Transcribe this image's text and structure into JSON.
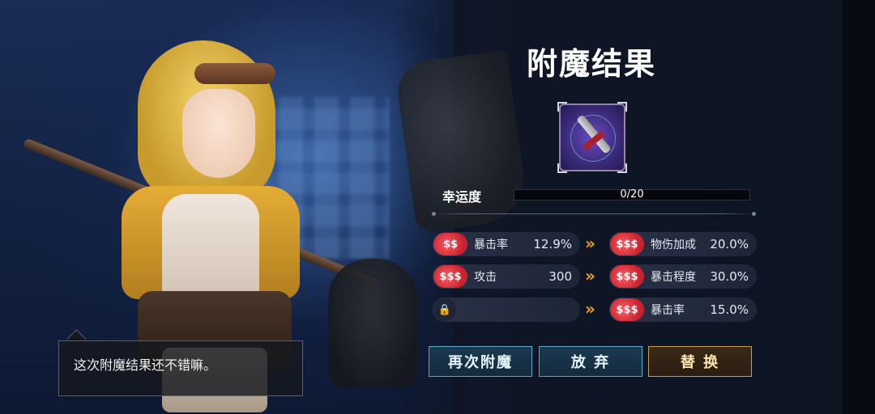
{
  "title": "附魔结果",
  "dialogue": {
    "text": "这次附魔结果还不错嘛。"
  },
  "luck": {
    "label": "幸运度",
    "value": "0/20",
    "progress": 0
  },
  "old_stats": [
    {
      "icon": "$$",
      "name": "暴击率",
      "value": "12.9%"
    },
    {
      "icon": "$$$",
      "name": "攻击",
      "value": "300"
    },
    {
      "icon": "lock",
      "name": "",
      "value": ""
    }
  ],
  "new_stats": [
    {
      "icon": "$$$",
      "name": "物伤加成",
      "value": "20.0%"
    },
    {
      "icon": "$$$",
      "name": "暴击程度",
      "value": "30.0%"
    },
    {
      "icon": "$$$",
      "name": "暴击率",
      "value": "15.0%"
    }
  ],
  "arrow": "»",
  "buttons": {
    "reenchant": "再次附魔",
    "abandon": "放 弃",
    "replace": "替 换"
  },
  "colors": {
    "accent_gold": "#f0a12a",
    "stat_red": "#e8303c",
    "button_blue": "#5fa6c8",
    "button_gold": "#c99a52"
  }
}
